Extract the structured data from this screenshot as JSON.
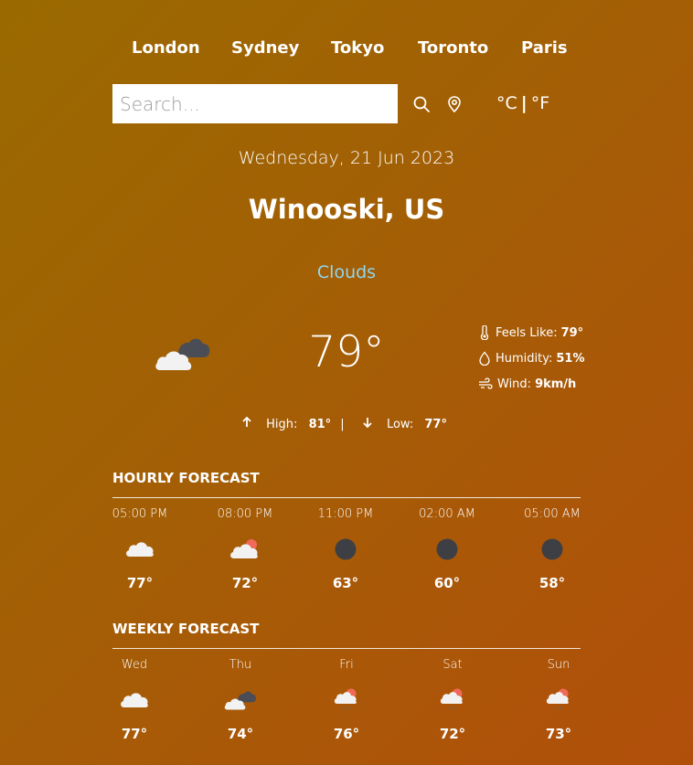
{
  "cities": [
    "London",
    "Sydney",
    "Tokyo",
    "Toronto",
    "Paris"
  ],
  "search": {
    "placeholder": "Search...",
    "value": ""
  },
  "units": {
    "celsius": "°C",
    "separator": "|",
    "fahrenheit": "°F"
  },
  "date": "Wednesday, 21 Jun 2023",
  "location": "Winooski, US",
  "condition": "Clouds",
  "current": {
    "temp": "79°",
    "icon": "broken-clouds-icon",
    "details": [
      {
        "label": "Feels Like:",
        "value": "79°",
        "icon": "thermometer-icon"
      },
      {
        "label": "Humidity:",
        "value": "51%",
        "icon": "droplet-icon"
      },
      {
        "label": "Wind:",
        "value": "9km/h",
        "icon": "wind-icon"
      }
    ],
    "high_label": "High:",
    "high": "81°",
    "divider": "|",
    "low_label": "Low:",
    "low": "77°"
  },
  "hourly": {
    "title": "HOURLY FORECAST",
    "items": [
      {
        "title": "05:00 PM",
        "temp": "77°",
        "icon": "cloud-icon"
      },
      {
        "title": "08:00 PM",
        "temp": "72°",
        "icon": "cloud-sun-icon"
      },
      {
        "title": "11:00 PM",
        "temp": "63°",
        "icon": "clear-night-icon"
      },
      {
        "title": "02:00 AM",
        "temp": "60°",
        "icon": "clear-night-icon"
      },
      {
        "title": "05:00 AM",
        "temp": "58°",
        "icon": "clear-night-icon"
      }
    ]
  },
  "weekly": {
    "title": "WEEKLY FORECAST",
    "items": [
      {
        "title": "Wed",
        "temp": "77°",
        "icon": "cloud-icon"
      },
      {
        "title": "Thu",
        "temp": "74°",
        "icon": "broken-clouds-icon"
      },
      {
        "title": "Fri",
        "temp": "76°",
        "icon": "rain-sun-icon"
      },
      {
        "title": "Sat",
        "temp": "72°",
        "icon": "rain-sun-icon"
      },
      {
        "title": "Sun",
        "temp": "73°",
        "icon": "rain-sun-icon"
      }
    ]
  },
  "colors": {
    "condition": "#8fd6f0",
    "background_start": "#9a6a00",
    "background_end": "#b14f0a"
  }
}
